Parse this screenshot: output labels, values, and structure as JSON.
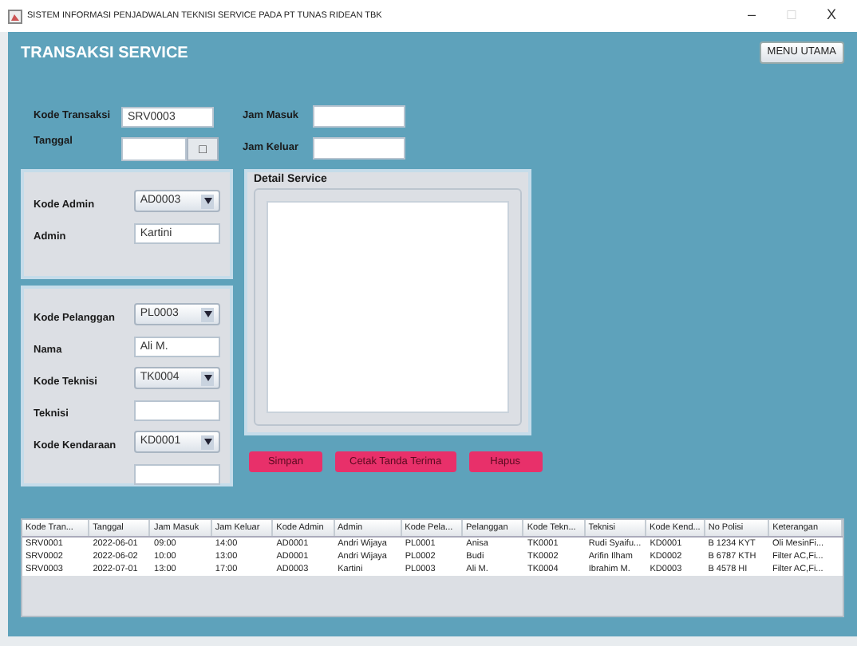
{
  "window": {
    "title": "SISTEM INFORMASI PENJADWALAN TEKNISI SERVICE PADA PT TUNAS RIDEAN TBK",
    "controls": [
      "–",
      "□",
      "X"
    ]
  },
  "heading": "TRANSAKSI SERVICE",
  "menu_button": "MENU UTAMA",
  "kode_transaksi": {
    "label": "Kode Transaksi",
    "value": "SRV0003"
  },
  "jam_masuk": {
    "label": "Jam Masuk"
  },
  "tanggal": {
    "label": "Tanggal",
    "button": "□"
  },
  "jam_keluar": {
    "label": "Jam Keluar"
  },
  "admin_panel": [
    {
      "kind": "combo",
      "label": "Kode Admin",
      "value": "AD0003"
    },
    {
      "kind": "text",
      "label": "Admin",
      "value": "Kartini"
    }
  ],
  "pelanggan_panel": [
    {
      "kind": "combo",
      "label": "Kode Pelanggan",
      "value": "PL0003"
    },
    {
      "kind": "text",
      "label": "Nama",
      "value": "Ali M."
    },
    {
      "kind": "combo",
      "label": "Kode Teknisi",
      "value": "TK0004"
    },
    {
      "kind": "text",
      "label": "Teknisi"
    },
    {
      "kind": "combo",
      "label": "Kode Kendaraan",
      "value": "KD0001"
    },
    {
      "kind": "text"
    }
  ],
  "detail_service": {
    "label": "Detail Service"
  },
  "buttons": [
    "Simpan",
    "Cetak Tanda Terima",
    "Hapus"
  ],
  "table": {
    "columns": [
      "Kode Tran...",
      "Tanggal",
      "Jam Masuk",
      "Jam Keluar",
      "Kode Admin",
      "Admin",
      "Kode Pela...",
      "Pelanggan",
      "Kode Tekn...",
      "Teknisi",
      "Kode Kend...",
      "No Polisi",
      "Keterangan"
    ],
    "rows": [
      [
        "SRV0001",
        "2022-06-01",
        "09:00",
        "14:00",
        "AD0001",
        "Andri Wijaya",
        "PL0001",
        "Anisa",
        "TK0001",
        "Rudi Syaifu...",
        "KD0001",
        "B 1234 KYT",
        "Oli MesinFi..."
      ],
      [
        "SRV0002",
        "2022-06-02",
        "10:00",
        "13:00",
        "AD0001",
        "Andri Wijaya",
        "PL0002",
        "Budi",
        "TK0002",
        "Arifin Ilham",
        "KD0002",
        "B 6787 KTH",
        "Filter AC,Fi..."
      ],
      [
        "SRV0003",
        "2022-07-01",
        "13:00",
        "17:00",
        "AD0003",
        "Kartini",
        "PL0003",
        "Ali M.",
        "TK0004",
        "Ibrahim M.",
        "KD0003",
        "B 4578 HI",
        "Filter AC,Fi..."
      ]
    ]
  }
}
